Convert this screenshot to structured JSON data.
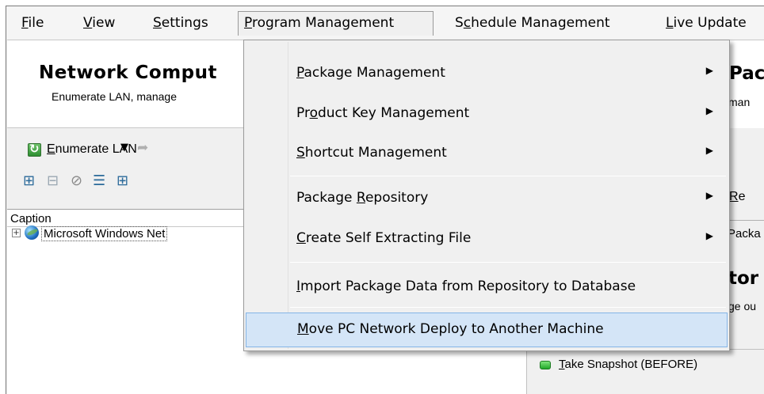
{
  "menubar": {
    "items": [
      {
        "pre": "",
        "u": "F",
        "post": "ile"
      },
      {
        "pre": "",
        "u": "V",
        "post": "iew"
      },
      {
        "pre": "",
        "u": "S",
        "post": "ettings"
      },
      {
        "pre": "",
        "u": "P",
        "post": "rogram Management"
      },
      {
        "pre": "S",
        "u": "c",
        "post": "hedule Management"
      },
      {
        "pre": "",
        "u": "L",
        "post": "ive Update"
      }
    ]
  },
  "left": {
    "title": "Network Comput",
    "subtitle": "Enumerate LAN, manage",
    "enumerate": {
      "u": "E",
      "post": "numerate LAN"
    },
    "forward_label": "E",
    "caption": "Caption",
    "tree_item": "Microsoft Windows Net"
  },
  "right": {
    "title": "Pac",
    "subtitle": "man",
    "re": {
      "u": "R",
      "post": "e"
    },
    "packa": "Packa",
    "tor": "tor",
    "ge": "ge ou",
    "snapshot": {
      "u": "T",
      "post": "ake Snapshot (BEFORE)"
    }
  },
  "dropdown": {
    "items": [
      {
        "pre": "",
        "u": "P",
        "post": "ackage Management",
        "submenu": true
      },
      {
        "pre": "Pr",
        "u": "o",
        "post": "duct Key Management",
        "submenu": true
      },
      {
        "pre": "",
        "u": "S",
        "post": "hortcut Management",
        "submenu": true
      },
      {
        "pre": "Package ",
        "u": "R",
        "post": "epository",
        "submenu": true
      },
      {
        "pre": "",
        "u": "C",
        "post": "reate Self Extracting File",
        "submenu": true
      },
      {
        "pre": "",
        "u": "I",
        "post": "mport Package Data from Repository to Database",
        "submenu": false
      },
      {
        "pre": "",
        "u": "M",
        "post": "ove PC Network Deploy to Another Machine",
        "submenu": false
      }
    ]
  },
  "icons": {
    "refresh": "refresh-icon",
    "forward": "forward-icon",
    "globe": "globe-icon",
    "submenu_arrow": "submenu-arrow-icon",
    "snapshot": "green-status-icon"
  }
}
